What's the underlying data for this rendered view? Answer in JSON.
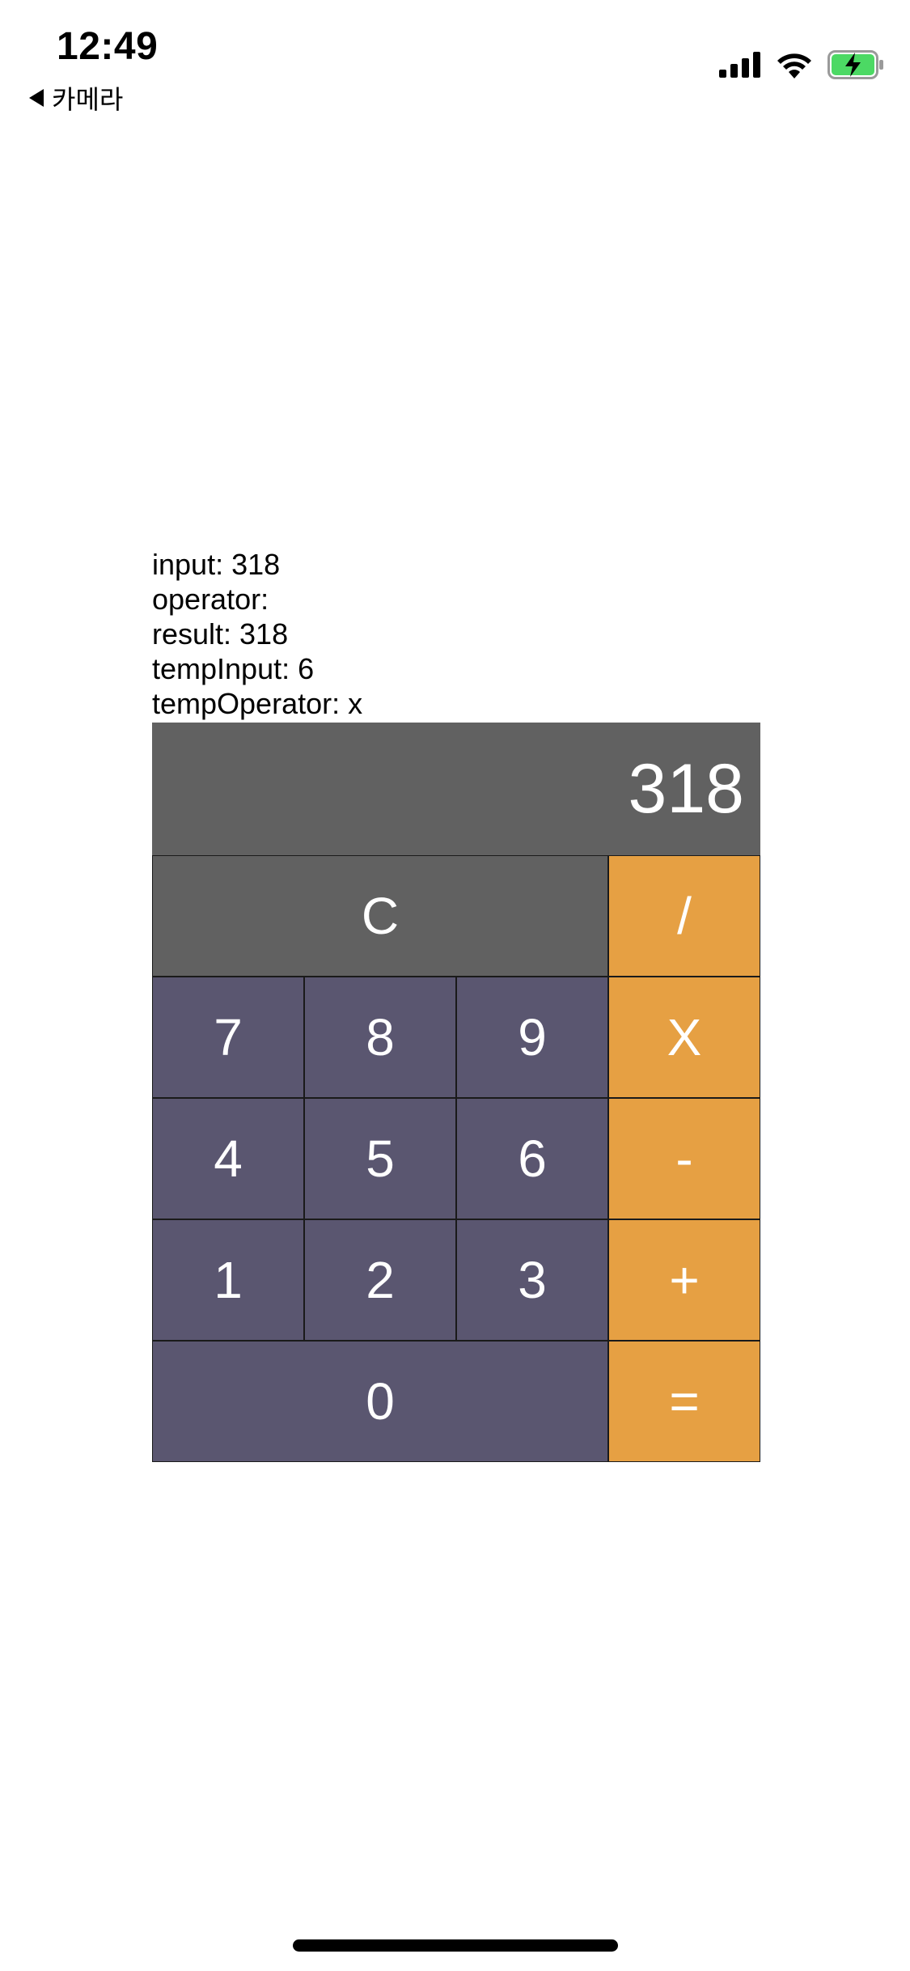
{
  "status_bar": {
    "time": "12:49",
    "back_label": "카메라",
    "icons": [
      "cellular-signal-icon",
      "wifi-icon",
      "battery-charging-icon"
    ],
    "battery_color": "#4cd964"
  },
  "debug": {
    "input": "input: 318",
    "operator": "operator:",
    "result": "result: 318",
    "temp_input": "tempInput: 6",
    "temp_operator": "tempOperator: x"
  },
  "calculator": {
    "display": "318",
    "keys": {
      "clear": "C",
      "divide": "/",
      "seven": "7",
      "eight": "8",
      "nine": "9",
      "multiply": "X",
      "four": "4",
      "five": "5",
      "six": "6",
      "minus": "-",
      "one": "1",
      "two": "2",
      "three": "3",
      "plus": "+",
      "zero": "0",
      "equals": "="
    },
    "colors": {
      "display_bg": "#616161",
      "number_bg": "#5a5670",
      "operator_bg": "#e6a043",
      "clear_bg": "#616161"
    }
  }
}
